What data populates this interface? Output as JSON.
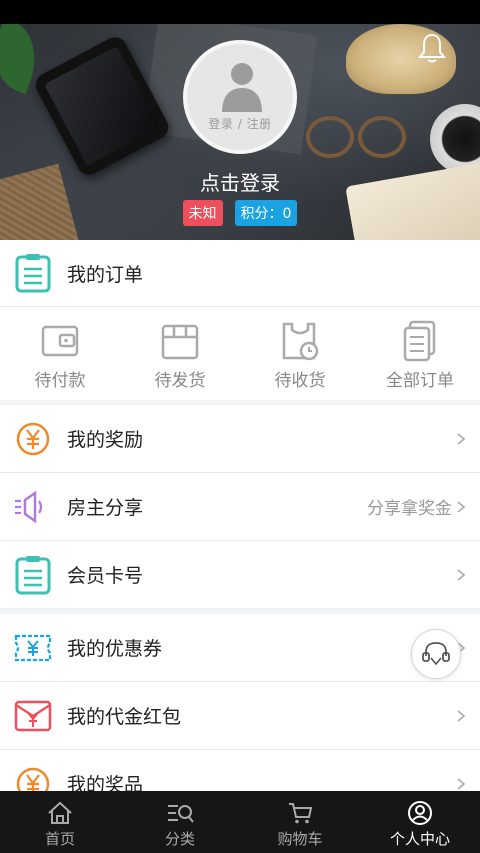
{
  "hero": {
    "avatar_text": "登录 / 注册",
    "login_title": "点击登录",
    "badge_unknown": "未知",
    "badge_points": "积分：0"
  },
  "orders": {
    "header_label": "我的订单",
    "tabs": [
      {
        "label": "待付款",
        "icon": "wallet-icon"
      },
      {
        "label": "待发货",
        "icon": "box-icon"
      },
      {
        "label": "待收货",
        "icon": "package-clock-icon"
      },
      {
        "label": "全部订单",
        "icon": "order-list-icon"
      }
    ]
  },
  "menu_group1": [
    {
      "label": "我的奖励",
      "icon": "yen-circle-icon",
      "right": ""
    },
    {
      "label": "房主分享",
      "icon": "megaphone-icon",
      "right": "分享拿奖金"
    },
    {
      "label": "会员卡号",
      "icon": "member-card-icon",
      "right": ""
    }
  ],
  "menu_group2": [
    {
      "label": "我的优惠券",
      "icon": "coupon-icon",
      "right": ""
    },
    {
      "label": "我的代金红包",
      "icon": "red-envelope-icon",
      "right": ""
    },
    {
      "label": "我的奖品",
      "icon": "prize-icon",
      "right": ""
    }
  ],
  "bottom_nav": [
    {
      "label": "首页",
      "icon": "home-icon",
      "active": false
    },
    {
      "label": "分类",
      "icon": "category-icon",
      "active": false
    },
    {
      "label": "购物车",
      "icon": "cart-icon",
      "active": false
    },
    {
      "label": "个人中心",
      "icon": "profile-icon",
      "active": true
    }
  ],
  "colors": {
    "teal": "#3cc0b4",
    "orange": "#f08a28",
    "purple": "#b27ad8",
    "red": "#ee4f5c",
    "blue": "#1aa2e3",
    "nav_bg": "#161616"
  }
}
